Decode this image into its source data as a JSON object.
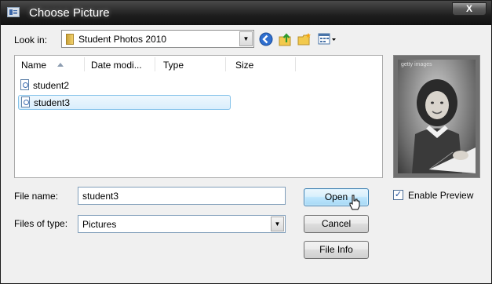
{
  "window": {
    "title": "Choose Picture",
    "close_glyph": "X",
    "icon": "picture-dialog-icon"
  },
  "toolbar": {
    "look_in_label": "Look in:",
    "look_in_value": "Student Photos 2010",
    "icons": [
      "back-icon",
      "up-folder-icon",
      "new-folder-icon",
      "views-menu-icon"
    ]
  },
  "file_list": {
    "columns": [
      "Name",
      "Date modi...",
      "Type",
      "Size"
    ],
    "files": [
      {
        "name": "student2",
        "selected": false
      },
      {
        "name": "student3",
        "selected": true
      }
    ]
  },
  "form": {
    "file_name_label": "File name:",
    "file_name_value": "student3",
    "file_type_label": "Files of type:",
    "file_type_value": "Pictures"
  },
  "buttons": {
    "open": "Open",
    "cancel": "Cancel",
    "file_info": "File Info"
  },
  "preview": {
    "enable_label": "Enable Preview",
    "enabled": true,
    "watermark": "getty images"
  },
  "colors": {
    "selection_border": "#84c2ea",
    "default_button": "#3c7fb1",
    "titlebar": "#1e1e1e"
  }
}
